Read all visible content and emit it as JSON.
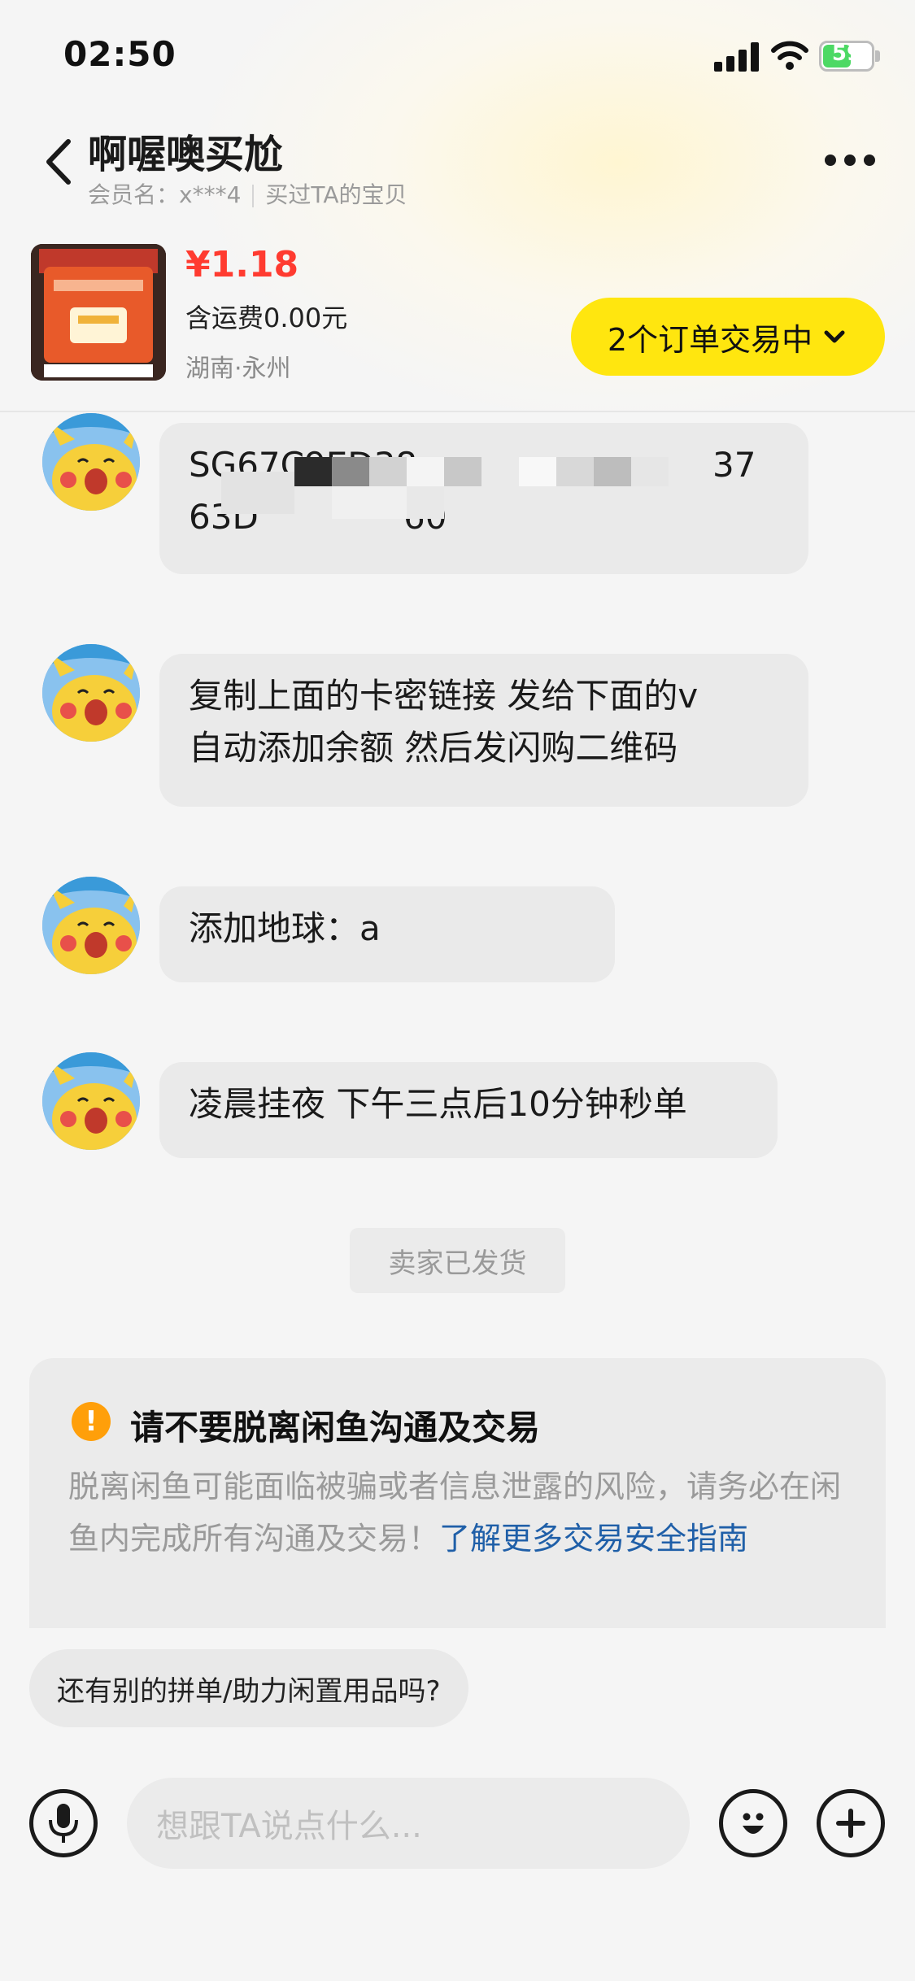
{
  "status_bar": {
    "time": "02:50",
    "battery": "59",
    "battery_level": 0.59
  },
  "header": {
    "title": "啊喔噢买尬",
    "member_label": "会员名：x***4",
    "relation": "买过TA的宝贝",
    "more_icon": "more-dots-icon",
    "back_icon": "chevron-left-icon"
  },
  "product": {
    "price": "¥1.18",
    "shipping": "含运费0.00元",
    "location": "湖南·永州",
    "order_status": "2个订单交易中"
  },
  "messages": [
    {
      "line1": "SG67C9ED38",
      "line2": "63D",
      "tail1": "37",
      "tail2": "60"
    },
    {
      "line1": "复制上面的卡密链接 发给下面的v",
      "line2": "自动添加余额 然后发闪购二维码"
    },
    {
      "text": "添加地球：a"
    },
    {
      "text": "凌晨挂夜 下午三点后10分钟秒单"
    }
  ],
  "system_tag": "卖家已发货",
  "warning": {
    "title": "请不要脱离闲鱼沟通及交易",
    "body": "脱离闲鱼可能面临被骗或者信息泄露的风险，请务必在闲鱼内完成所有沟通及交易！",
    "link": "了解更多交易安全指南"
  },
  "quick_reply": "还有别的拼单/助力闲置用品吗?",
  "input": {
    "placeholder": "想跟TA说点什么..."
  },
  "colors": {
    "accent_yellow": "#ffe60f",
    "price_red": "#ff3b30",
    "link_blue": "#1f5fa8",
    "warning_orange": "#ff9f0a"
  }
}
